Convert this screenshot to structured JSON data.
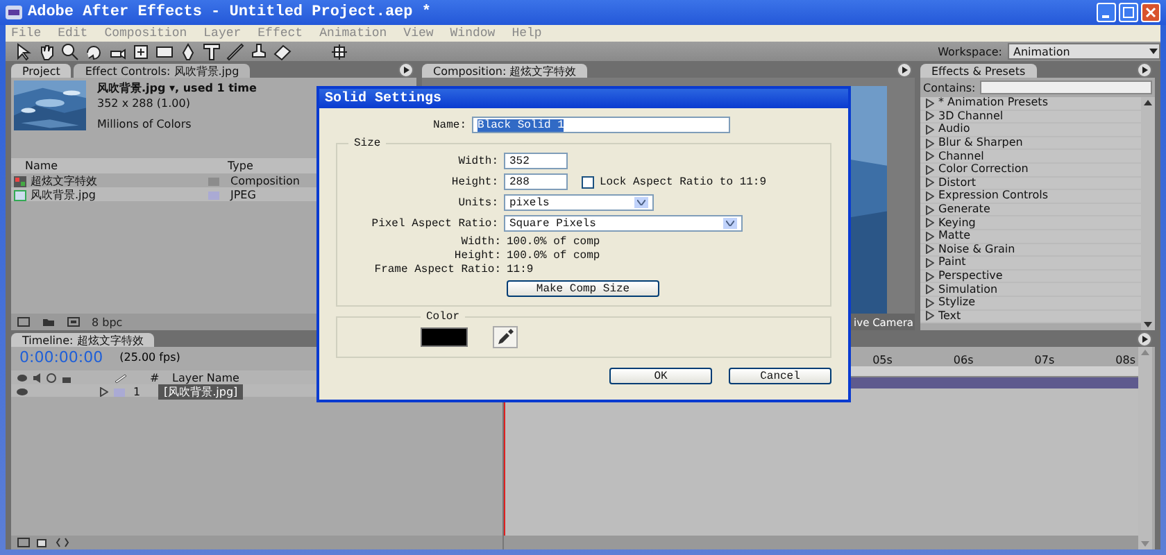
{
  "window": {
    "title": "Adobe After Effects - Untitled Project.aep *"
  },
  "menu": [
    "File",
    "Edit",
    "Composition",
    "Layer",
    "Effect",
    "Animation",
    "View",
    "Window",
    "Help"
  ],
  "workspace": {
    "label": "Workspace:",
    "value": "Animation"
  },
  "project_panel": {
    "tabs": [
      {
        "label": "Project",
        "selected": true
      },
      {
        "label": "Effect Controls: 风吹背景.jpg",
        "selected": false
      }
    ],
    "info": {
      "name": "风吹背景.jpg ▾, used 1 time",
      "size": "352 x 288 (1.00)",
      "colors": "Millions of Colors"
    },
    "columns": [
      "Name",
      "Type"
    ],
    "items": [
      {
        "name": "超炫文字特效",
        "type": "Composition",
        "kind": "composition",
        "color": "#8c8c8c",
        "selected": false
      },
      {
        "name": "风吹背景.jpg",
        "type": "JPEG",
        "kind": "footage",
        "color": "#aaaad4",
        "selected": true
      }
    ],
    "depth": "8 bpc"
  },
  "composition_panel": {
    "tab": "Composition: 超炫文字特效",
    "view": "ive Camera"
  },
  "effects_panel": {
    "tab": "Effects & Presets",
    "contains_label": "Contains:",
    "items": [
      "* Animation Presets",
      "3D Channel",
      "Audio",
      "Blur & Sharpen",
      "Channel",
      "Color Correction",
      "Distort",
      "Expression Controls",
      "Generate",
      "Keying",
      "Matte",
      "Noise & Grain",
      "Paint",
      "Perspective",
      "Simulation",
      "Stylize",
      "Text"
    ]
  },
  "timeline": {
    "tab": "Timeline: 超炫文字特效",
    "timecode": "0:00:00:00",
    "fps": "(25.00 fps)",
    "number_header": "#",
    "name_header": "Layer Name",
    "layers": [
      {
        "number": "1",
        "name": "[风吹背景.jpg]",
        "selected": true,
        "color": "#aaaad4"
      }
    ],
    "ruler": [
      "05s",
      "06s",
      "07s",
      "08s"
    ]
  },
  "dialog": {
    "title": "Solid Settings",
    "name_label": "Name:",
    "name_value": "Black Solid 1",
    "size_section": "Size",
    "width_label": "Width:",
    "width_value": "352",
    "height_label": "Height:",
    "height_value": "288",
    "lock": {
      "label": "Lock Aspect Ratio to 11:9",
      "checked": false
    },
    "units_label": "Units:",
    "units_value": "pixels",
    "par_label": "Pixel Aspect Ratio:",
    "par_value": "Square Pixels",
    "info": [
      {
        "label": "Width:",
        "value": "100.0% of comp"
      },
      {
        "label": "Height:",
        "value": "100.0% of comp"
      },
      {
        "label": "Frame Aspect Ratio:",
        "value": "11:9"
      }
    ],
    "make_comp_size": "Make Comp Size",
    "color_section": "Color",
    "color": "#000000",
    "buttons": [
      "OK",
      "Cancel"
    ]
  }
}
